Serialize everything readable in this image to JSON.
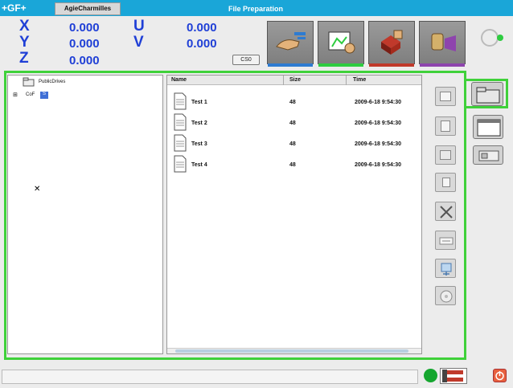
{
  "header": {
    "brand": "+GF+",
    "vendor": "AgieCharmilles",
    "title": "File Preparation"
  },
  "coordinates": {
    "x": {
      "axis": "X",
      "value": "0.000"
    },
    "y": {
      "axis": "Y",
      "value": "0.000"
    },
    "z": {
      "axis": "Z",
      "value": "0.000"
    },
    "u": {
      "axis": "U",
      "value": "0.000"
    },
    "v": {
      "axis": "V",
      "value": "0.000"
    },
    "cs_label": "CS0"
  },
  "modes": [
    {
      "name": "setup-mode",
      "icon": "hand-gauge-icon",
      "bar_color": "#2e7bd1"
    },
    {
      "name": "preparation-mode",
      "icon": "preparation-icon",
      "bar_color": "#2ecc40"
    },
    {
      "name": "execution-mode",
      "icon": "cubes-icon",
      "bar_color": "#c0392b"
    },
    {
      "name": "maintenance-mode",
      "icon": "tools-icon",
      "bar_color": "#8e44ad"
    }
  ],
  "tree": {
    "root_label": "PublicDrives",
    "child_label": "CoF",
    "child_tag": "S"
  },
  "file_list": {
    "columns": {
      "name": "Name",
      "size": "Size",
      "time": "Time"
    },
    "rows": [
      {
        "name": "Test 1",
        "size": "48",
        "time": "2009-6-18 9:54:30"
      },
      {
        "name": "Test 2",
        "size": "48",
        "time": "2009-6-18 9:54:30"
      },
      {
        "name": "Test 3",
        "size": "48",
        "time": "2009-6-18 9:54:30"
      },
      {
        "name": "Test 4",
        "size": "48",
        "time": "2009-6-18 9:54:30"
      }
    ]
  },
  "side_buttons": [
    {
      "name": "new-folder-button",
      "icon": "folder-icon"
    },
    {
      "name": "new-file-button",
      "icon": "document-icon"
    },
    {
      "name": "copy-button",
      "icon": "copy-icon"
    },
    {
      "name": "paste-button",
      "icon": "paste-icon"
    },
    {
      "name": "delete-button",
      "icon": "cut-x-icon"
    },
    {
      "name": "rename-button",
      "icon": "rename-icon"
    },
    {
      "name": "transfer-button",
      "icon": "transfer-icon"
    },
    {
      "name": "properties-button",
      "icon": "disc-icon"
    }
  ],
  "right_tabs": [
    {
      "name": "file-manager-tab",
      "icon": "folder-icon"
    },
    {
      "name": "editor-tab",
      "icon": "window-icon"
    },
    {
      "name": "device-tab",
      "icon": "device-icon"
    }
  ],
  "status": {
    "text": ""
  },
  "colors": {
    "accent": "#1aa6d8",
    "frame": "#3fd13a",
    "coord_text": "#1f3fd6"
  }
}
